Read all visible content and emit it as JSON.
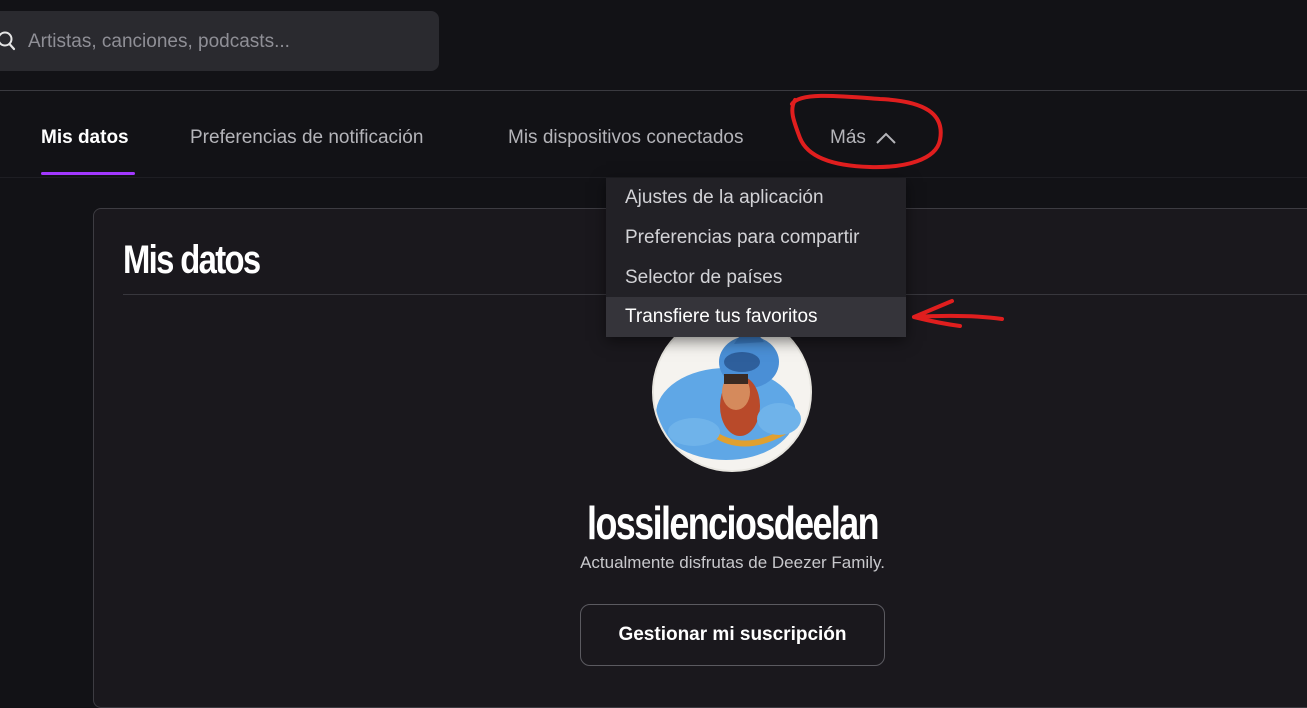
{
  "search": {
    "placeholder": "Artistas, canciones, podcasts..."
  },
  "tabs": [
    {
      "label": "Mis datos",
      "active": true
    },
    {
      "label": "Preferencias de notificación",
      "active": false
    },
    {
      "label": "Mis dispositivos conectados",
      "active": false
    },
    {
      "label": "Más",
      "active": false
    }
  ],
  "more_menu": {
    "items": [
      {
        "label": "Ajustes de la aplicación"
      },
      {
        "label": "Preferencias para compartir"
      },
      {
        "label": "Selector de países"
      },
      {
        "label": "Transfiere tus favoritos",
        "highlighted": true
      }
    ]
  },
  "profile": {
    "section_title": "Mis datos",
    "username": "lossilenciosdeelan",
    "plan_text": "Actualmente disfrutas de Deezer Family.",
    "manage_button": "Gestionar mi suscripción"
  },
  "colors": {
    "accent": "#a238ff",
    "background": "#121216",
    "annotation": "#e01e1e"
  }
}
